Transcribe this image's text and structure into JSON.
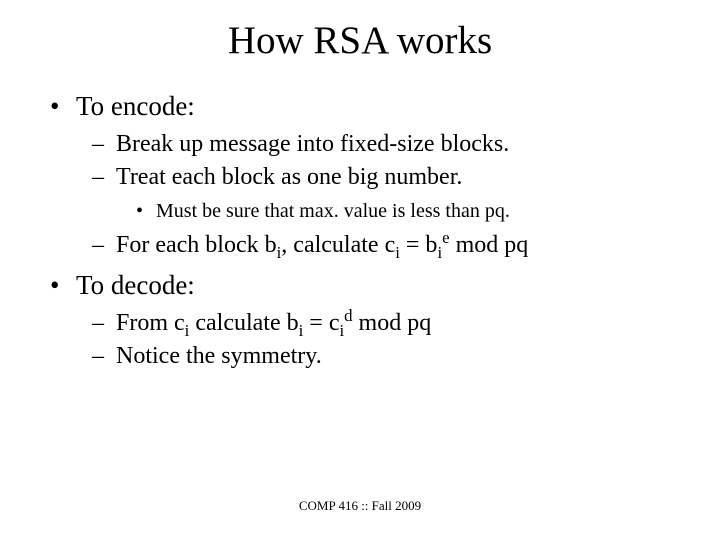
{
  "title": "How RSA works",
  "b1": "To encode:",
  "b1a": "Break up message into fixed-size blocks.",
  "b1b": "Treat each block as one big number.",
  "b1b1": "Must be sure that max. value is less than pq.",
  "b1c_pre": "For each block b",
  "sub_i1": "i",
  "b1c_mid": ", calculate c",
  "sub_i2": "i",
  "eq1": " = b",
  "sub_i3": "i",
  "sup_e": "e",
  "modpq1": " mod pq",
  "b2": "To decode:",
  "b2a_pre": "From c",
  "sub_i4": "i",
  "b2a_mid": " calculate b",
  "sub_i5": "i",
  "eq2": " = c",
  "sub_i6": "i",
  "sup_d": "d",
  "modpq2": " mod pq",
  "b2b": "Notice the symmetry.",
  "footer": "COMP 416 :: Fall 2009"
}
